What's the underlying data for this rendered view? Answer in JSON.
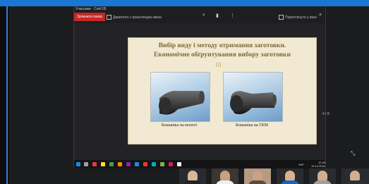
{
  "meeting": {
    "share_title": "Учасники · Conf 05",
    "stop_share_label": "Зупинити показ",
    "doc_name": "Дивитися з трансляцією вікна",
    "right_label": "Переглянути у вікні",
    "pager": "4 / 8"
  },
  "slide": {
    "title_line1": "Вибір виду і методу отримання заготовки.",
    "title_line2": "Економічне обґрунтування вибору заготовки",
    "ornament": "ᘏ",
    "images": [
      {
        "caption": "Кошаніка на молоті"
      },
      {
        "caption": "Кошаніка на ГКМ"
      }
    ]
  },
  "taskbar": {
    "tray_lang": "УКР",
    "clock_time": "10:45",
    "clock_date": "19.10.2021"
  },
  "colors": {
    "accent": "#1976d2",
    "stop": "#c62828",
    "slide_bg": "#f1e9d2",
    "title": "#7b6a35"
  },
  "icons": [
    "search-icon",
    "trash-icon",
    "more-icon",
    "close-icon",
    "windows-icon",
    "resize-icon"
  ]
}
